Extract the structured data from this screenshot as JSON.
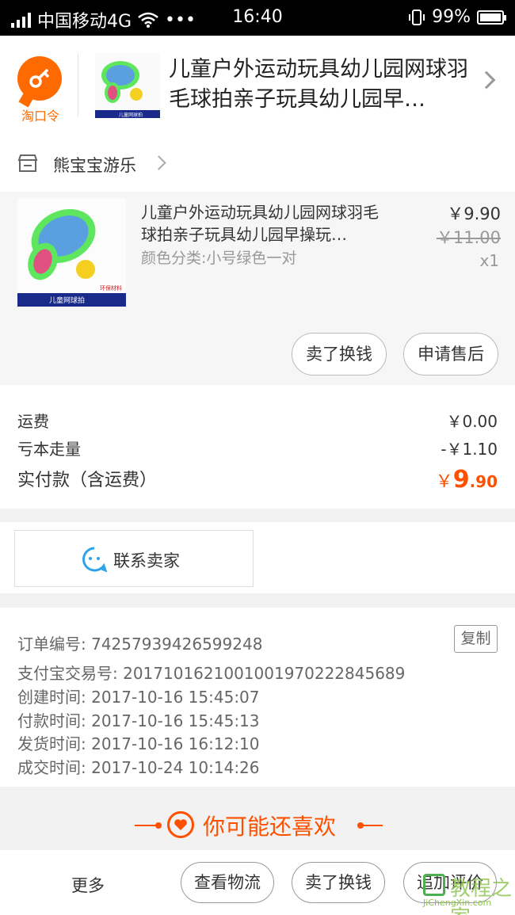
{
  "status_bar": {
    "carrier": "中国移动4G",
    "dots": "•••",
    "time": "16:40",
    "battery": "99%"
  },
  "tao_code": {
    "label": "淘口令",
    "title": "儿童户外运动玩具幼儿园网球羽毛球拍亲子玩具幼儿园早…",
    "product_image_caption": "儿童网球拍"
  },
  "shop": {
    "name": "熊宝宝游乐"
  },
  "product": {
    "title": "儿童户外运动玩具幼儿园网球羽毛球拍亲子玩具幼儿园早操玩…",
    "sku": "颜色分类:小号绿色一对",
    "price": "￥9.90",
    "original_price": "￥11.00",
    "quantity": "x1",
    "sell_label": "卖了换钱",
    "after_sale_label": "申请售后",
    "image_caption": "儿童网球拍",
    "image_badge": "环保材料"
  },
  "summary": {
    "shipping_label": "运费",
    "shipping_value": "￥0.00",
    "discount_label": "亏本走量",
    "discount_value": "-￥1.10",
    "total_label": "实付款（含运费）",
    "total_symbol": "￥",
    "total_int": "9",
    "total_dec": ".90"
  },
  "contact": {
    "label": "联系卖家"
  },
  "order_info": {
    "order_no": "订单编号: 74257939426599248",
    "copy_label": "复制",
    "alipay_no": "支付宝交易号: 2017101621001001970222845689",
    "created": "创建时间: 2017-10-16 15:45:07",
    "paid": "付款时间: 2017-10-16 15:45:13",
    "shipped": "发货时间: 2017-10-16 16:12:10",
    "completed": "成交时间: 2017-10-24 10:14:26"
  },
  "recommend": {
    "title": "你可能还喜欢"
  },
  "bottom_bar": {
    "more": "更多",
    "logistics": "查看物流",
    "sell": "卖了换钱",
    "review": "追加评价"
  },
  "watermark": {
    "cn": "教程之家",
    "en": "JiChengXin.com"
  },
  "colors": {
    "accent": "#ff5000",
    "tao_orange": "#ff6a00"
  }
}
